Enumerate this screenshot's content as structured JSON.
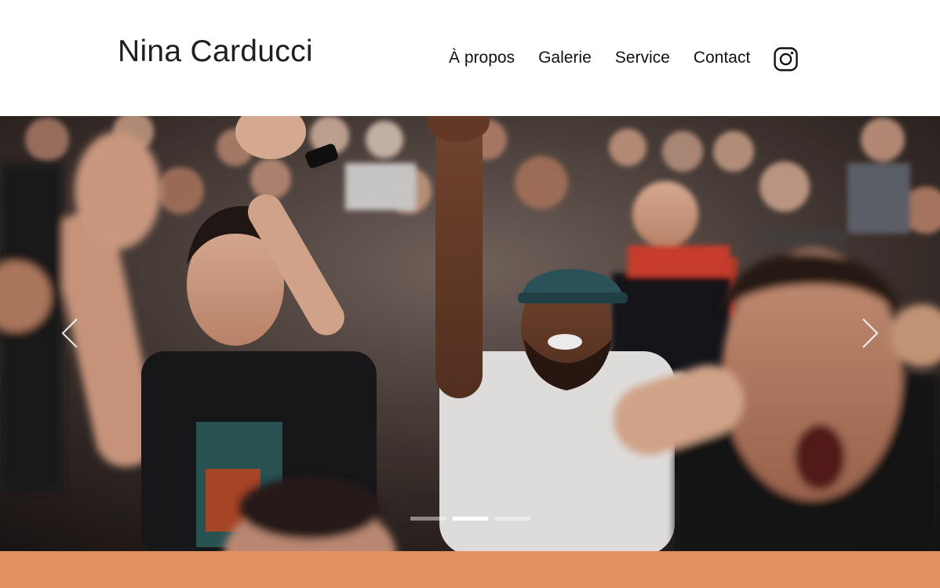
{
  "header": {
    "brand": "Nina Carducci",
    "nav": {
      "about": "À propos",
      "gallery": "Galerie",
      "service": "Service",
      "contact": "Contact",
      "instagram_icon": "instagram-icon"
    }
  },
  "carousel": {
    "slide_image": "crowd-cheering-concert-photo",
    "prev_icon": "chevron-left-icon",
    "next_icon": "chevron-right-icon",
    "slide_count": 3,
    "active_slide": 2
  },
  "colors": {
    "accent_band": "#e2925e",
    "text": "#1f1f1f",
    "background": "#ffffff"
  }
}
